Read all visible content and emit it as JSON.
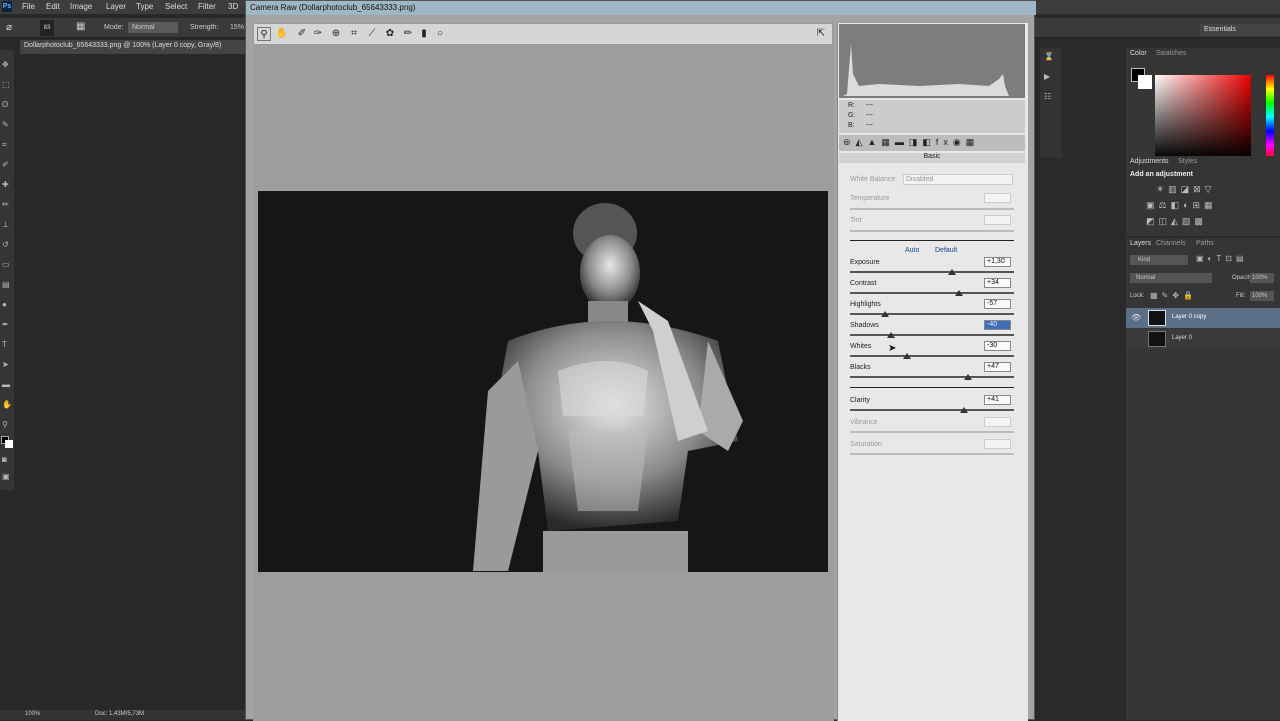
{
  "menubar": {
    "items": [
      "File",
      "Edit",
      "Image",
      "Layer",
      "Type",
      "Select",
      "Filter",
      "3D"
    ]
  },
  "options": {
    "brush_size": "83",
    "mode_label": "Mode:",
    "mode_value": "Normal",
    "strength_label": "Strength:",
    "strength_value": "15%"
  },
  "document": {
    "tab_title": "Dollarphotoclub_65643333.png @ 100% (Layer 0 copy, Gray/8)",
    "zoom": "100%",
    "doc_info": "Doc: 1,43M/5,73M"
  },
  "dialog": {
    "title": "Camera Raw (Dollarphotoclub_65643333.png)",
    "rgb": {
      "r": "R:",
      "g": "G:",
      "b": "B:",
      "r_val": "---",
      "g_val": "---",
      "b_val": "---"
    },
    "panel_title": "Basic",
    "white_balance": {
      "label": "White Balance:",
      "value": "Disabled"
    },
    "temperature": "Temperature",
    "tint": "Tint",
    "auto": "Auto",
    "default": "Default",
    "sliders": [
      {
        "label": "Exposure",
        "value": "+1,30"
      },
      {
        "label": "Contrast",
        "value": "+34"
      },
      {
        "label": "Highlights",
        "value": "-57"
      },
      {
        "label": "Shadows",
        "value": "-40"
      },
      {
        "label": "Whites",
        "value": "-30"
      },
      {
        "label": "Blacks",
        "value": "+47"
      }
    ],
    "clarity": {
      "label": "Clarity",
      "value": "+41"
    },
    "vibrance": "Vibrance",
    "saturation": "Saturation"
  },
  "rightpanel": {
    "workspace": "Essentials",
    "color_tabs": [
      "Color",
      "Swatches"
    ],
    "adj_tabs": [
      "Adjustments",
      "Styles"
    ],
    "adj_title": "Add an adjustment",
    "layer_tabs": [
      "Layers",
      "Channels",
      "Paths"
    ],
    "kind": "Kind",
    "blend": "Normal",
    "opacity_label": "Opacity:",
    "opacity": "100%",
    "lock_label": "Lock:",
    "fill_label": "Fill:",
    "fill": "100%",
    "layers": [
      "Layer 0 copy",
      "Layer 0"
    ]
  },
  "colors": {
    "accent": "#3f6db8",
    "selected_layer": "#5b6f86"
  }
}
